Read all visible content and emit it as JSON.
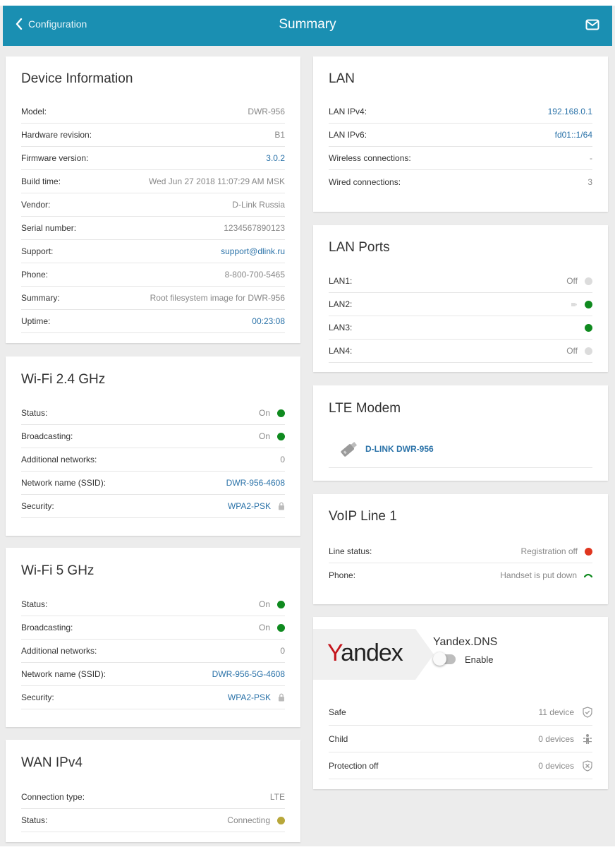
{
  "header": {
    "back_label": "Configuration",
    "title": "Summary"
  },
  "device_info": {
    "title": "Device Information",
    "rows": [
      {
        "label": "Model:",
        "value": "DWR-956"
      },
      {
        "label": "Hardware revision:",
        "value": "B1"
      },
      {
        "label": "Firmware version:",
        "value": "3.0.2"
      },
      {
        "label": "Build time:",
        "value": "Wed Jun 27 2018 11:07:29 AM MSK"
      },
      {
        "label": "Vendor:",
        "value": "D-Link Russia"
      },
      {
        "label": "Serial number:",
        "value": "1234567890123"
      },
      {
        "label": "Support:",
        "value": "support@dlink.ru"
      },
      {
        "label": "Phone:",
        "value": "8-800-700-5465"
      },
      {
        "label": "Summary:",
        "value": "Root filesystem image for DWR-956"
      },
      {
        "label": "Uptime:",
        "value": "00:23:08"
      }
    ]
  },
  "wifi24": {
    "title": "Wi-Fi 2.4 GHz",
    "rows": [
      {
        "label": "Status:",
        "value": "On"
      },
      {
        "label": "Broadcasting:",
        "value": "On"
      },
      {
        "label": "Additional networks:",
        "value": "0"
      },
      {
        "label": "Network name (SSID):",
        "value": "DWR-956-4608"
      },
      {
        "label": "Security:",
        "value": "WPA2-PSK"
      }
    ]
  },
  "wifi5": {
    "title": "Wi-Fi 5 GHz",
    "rows": [
      {
        "label": "Status:",
        "value": "On"
      },
      {
        "label": "Broadcasting:",
        "value": "On"
      },
      {
        "label": "Additional networks:",
        "value": "0"
      },
      {
        "label": "Network name (SSID):",
        "value": "DWR-956-5G-4608"
      },
      {
        "label": "Security:",
        "value": "WPA2-PSK"
      }
    ]
  },
  "wan": {
    "title": "WAN IPv4",
    "rows": [
      {
        "label": "Connection type:",
        "value": "LTE"
      },
      {
        "label": "Status:",
        "value": "Connecting"
      }
    ]
  },
  "lan": {
    "title": "LAN",
    "rows": [
      {
        "label": "LAN IPv4:",
        "value": "192.168.0.1"
      },
      {
        "label": "LAN IPv6:",
        "value": "fd01::1/64"
      },
      {
        "label": "Wireless connections:",
        "value": "-"
      },
      {
        "label": "Wired connections:",
        "value": "3"
      }
    ]
  },
  "lan_ports": {
    "title": "LAN Ports",
    "rows": [
      {
        "label": "LAN1:",
        "value": "Off"
      },
      {
        "label": "LAN2:",
        "value": ""
      },
      {
        "label": "LAN3:",
        "value": ""
      },
      {
        "label": "LAN4:",
        "value": "Off"
      }
    ]
  },
  "lte": {
    "title": "LTE Modem",
    "modem_name": "D-LINK DWR-956"
  },
  "voip": {
    "title": "VoIP Line 1",
    "rows": [
      {
        "label": "Line status:",
        "value": "Registration off"
      },
      {
        "label": "Phone:",
        "value": "Handset is put down"
      }
    ]
  },
  "yandex": {
    "logo_first": "Y",
    "logo_rest": "andex",
    "title": "Yandex.DNS",
    "toggle_label": "Enable",
    "rows": [
      {
        "label": "Safe",
        "value": "11 device"
      },
      {
        "label": "Child",
        "value": "0 devices"
      },
      {
        "label": "Protection off",
        "value": "0 devices"
      }
    ]
  },
  "colors": {
    "header_bg": "#1a8fb2",
    "link": "#2a72a8",
    "status_green": "#0f8a1f",
    "status_red": "#e0361f",
    "status_olive": "#b8a73a",
    "yandex_red": "#c4151c"
  }
}
